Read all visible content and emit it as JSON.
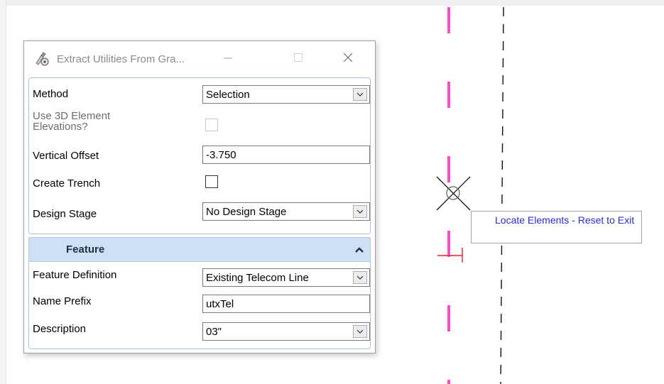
{
  "dialog": {
    "title": "Extract Utilities From Gra...",
    "icon": "extract-utilities-app-icon",
    "controls": {
      "minimize": "minimize-icon",
      "maximize": "maximize-icon",
      "close": "close-icon"
    }
  },
  "form": {
    "method": {
      "label": "Method",
      "value": "Selection"
    },
    "use_3d": {
      "label": "Use 3D Element Elevations?",
      "checked": false,
      "enabled": false
    },
    "vertical_offset": {
      "label": "Vertical Offset",
      "value": "-3.750"
    },
    "create_trench": {
      "label": "Create Trench",
      "checked": false
    },
    "design_stage": {
      "label": "Design Stage",
      "value": "No Design Stage"
    }
  },
  "feature": {
    "header": "Feature",
    "feature_definition": {
      "label": "Feature Definition",
      "value": "Existing Telecom Line"
    },
    "name_prefix": {
      "label": "Name Prefix",
      "value": "utxTel"
    },
    "description": {
      "label": "Description",
      "value": "03\""
    }
  },
  "tooltip": {
    "text": "Locate Elements - Reset to Exit"
  },
  "colors": {
    "telecom_line": "#ff4fc8",
    "marker": "#e02424",
    "tooltip_text": "#2b2bd9",
    "feature_header_bg": "#cfe0f2"
  }
}
